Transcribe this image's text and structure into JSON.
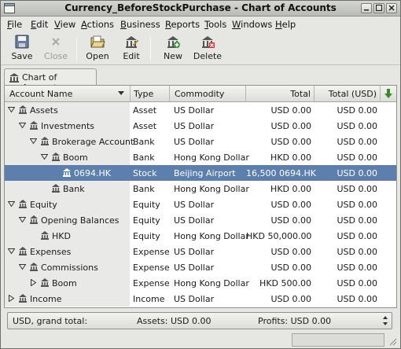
{
  "window": {
    "title": "Currency_BeforeStockPurchase - Chart of Accounts"
  },
  "menubar": [
    {
      "label": "File",
      "u": "F"
    },
    {
      "label": "Edit",
      "u": "E"
    },
    {
      "label": "View",
      "u": "V"
    },
    {
      "label": "Actions",
      "u": "A"
    },
    {
      "label": "Business",
      "u": "B"
    },
    {
      "label": "Reports",
      "u": "R"
    },
    {
      "label": "Tools",
      "u": "T"
    },
    {
      "label": "Windows",
      "u": "W"
    },
    {
      "label": "Help",
      "u": "H"
    }
  ],
  "toolbar": {
    "save": "Save",
    "close": "Close",
    "open": "Open",
    "edit": "Edit",
    "new": "New",
    "delete": "Delete"
  },
  "tab": {
    "label": "Chart of Accounts"
  },
  "columns": {
    "name": "Account Name",
    "type": "Type",
    "commodity": "Commodity",
    "total": "Total",
    "total_usd": "Total (USD)"
  },
  "accounts": [
    {
      "name": "Assets",
      "depth": 0,
      "expander": "open",
      "type": "Asset",
      "commodity": "US Dollar",
      "total": "USD 0.00",
      "total_usd": "USD 0.00"
    },
    {
      "name": "Investments",
      "depth": 1,
      "expander": "open",
      "type": "Asset",
      "commodity": "US Dollar",
      "total": "USD 0.00",
      "total_usd": "USD 0.00"
    },
    {
      "name": "Brokerage Account",
      "depth": 2,
      "expander": "open",
      "type": "Bank",
      "commodity": "US Dollar",
      "total": "USD 0.00",
      "total_usd": "USD 0.00"
    },
    {
      "name": "Boom",
      "depth": 3,
      "expander": "open",
      "type": "Bank",
      "commodity": "Hong Kong Dollar",
      "total": "HKD 0.00",
      "total_usd": "USD 0.00"
    },
    {
      "name": "0694.HK",
      "depth": 4,
      "expander": "none",
      "type": "Stock",
      "commodity": "Beijing Airport",
      "total": "16,500 0694.HK",
      "total_usd": "USD 0.00",
      "selected": true
    },
    {
      "name": "Bank",
      "depth": 3,
      "expander": "none",
      "type": "Bank",
      "commodity": "Hong Kong Dollar",
      "total": "HKD 0.00",
      "total_usd": "USD 0.00"
    },
    {
      "name": "Equity",
      "depth": 0,
      "expander": "open",
      "type": "Equity",
      "commodity": "US Dollar",
      "total": "USD 0.00",
      "total_usd": "USD 0.00"
    },
    {
      "name": "Opening Balances",
      "depth": 1,
      "expander": "open",
      "type": "Equity",
      "commodity": "US Dollar",
      "total": "USD 0.00",
      "total_usd": "USD 0.00"
    },
    {
      "name": "HKD",
      "depth": 2,
      "expander": "none",
      "type": "Equity",
      "commodity": "Hong Kong Dollar",
      "total": "HKD 50,000.00",
      "total_usd": "USD 0.00"
    },
    {
      "name": "Expenses",
      "depth": 0,
      "expander": "open",
      "type": "Expense",
      "commodity": "US Dollar",
      "total": "USD 0.00",
      "total_usd": "USD 0.00"
    },
    {
      "name": "Commissions",
      "depth": 1,
      "expander": "open",
      "type": "Expense",
      "commodity": "US Dollar",
      "total": "USD 0.00",
      "total_usd": "USD 0.00"
    },
    {
      "name": "Boom",
      "depth": 2,
      "expander": "closed",
      "type": "Expense",
      "commodity": "Hong Kong Dollar",
      "total": "HKD 500.00",
      "total_usd": "USD 0.00"
    },
    {
      "name": "Income",
      "depth": 0,
      "expander": "closed",
      "type": "Income",
      "commodity": "US Dollar",
      "total": "USD 0.00",
      "total_usd": "USD 0.00"
    }
  ],
  "summary": {
    "label": "USD, grand total:",
    "assets": "Assets: USD 0.00",
    "profits": "Profits: USD 0.00"
  },
  "colors": {
    "selection": "#5d7fae"
  }
}
